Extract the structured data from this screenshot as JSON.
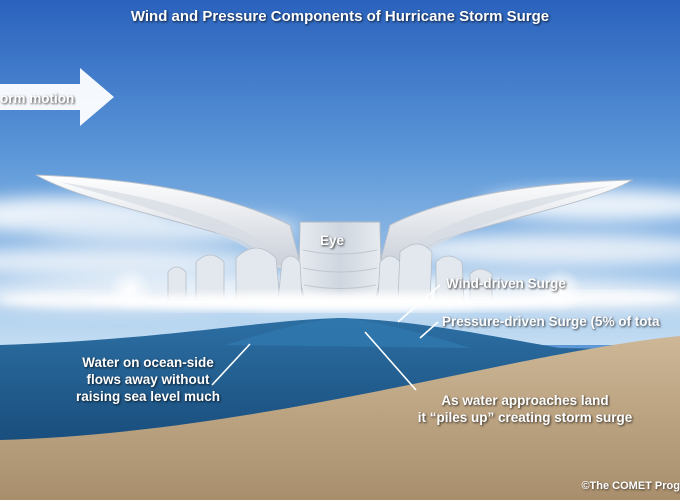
{
  "title": "Wind and Pressure Components of Hurricane Storm Surge",
  "labels": {
    "storm_motion": "orm motion",
    "eye": "Eye",
    "wind_driven_surge": "Wind-driven Surge",
    "pressure_driven_surge": "Pressure-driven Surge (5% of tota",
    "ocean_side_line1": "Water on ocean-side",
    "ocean_side_line2": "flows away without",
    "ocean_side_line3": "raising sea level much",
    "piles_up_line1": "As water approaches land",
    "piles_up_line2": "it “piles up” creating storm surge"
  },
  "credit": "©The COMET Prog",
  "colors": {
    "sky_top": "#2d66c0",
    "sky_bottom": "#bcd9f2",
    "ocean": "#1d5a8e",
    "land": "#c2ab8a",
    "arrow": "#ffffff"
  },
  "icons": {
    "motion_arrow": "right-arrow-icon"
  }
}
